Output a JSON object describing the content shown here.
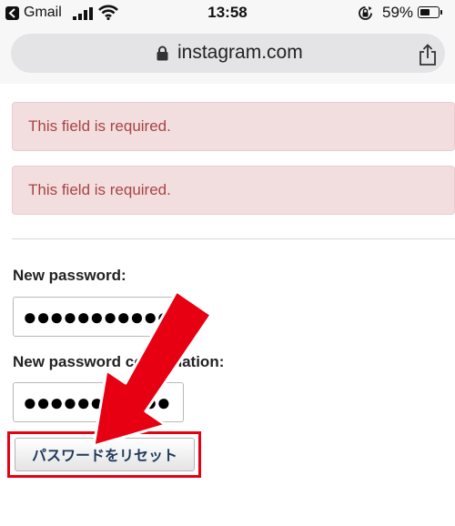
{
  "status_bar": {
    "carrier": "Gmail",
    "time": "13:58",
    "battery_percent": "59%",
    "battery_level": 0.59,
    "icons": [
      "back-to-app-icon",
      "signal-icon",
      "wifi-icon",
      "rotation-lock-icon",
      "battery-icon"
    ]
  },
  "browser": {
    "url": "instagram.com",
    "icons": [
      "lock-icon",
      "share-icon"
    ]
  },
  "errors": [
    {
      "text": "This field is required."
    },
    {
      "text": "This field is required."
    }
  ],
  "form": {
    "new_password_label": "New password:",
    "new_password_value": "●●●●●●●●●●●",
    "confirmation_label": "New password confirmation:",
    "confirmation_value": "●●●●●●●●●●●",
    "reset_button_label": "パスワードをリセット"
  },
  "colors": {
    "error_bg": "#f2dede",
    "error_text": "#a94442",
    "highlight": "#e60012"
  }
}
